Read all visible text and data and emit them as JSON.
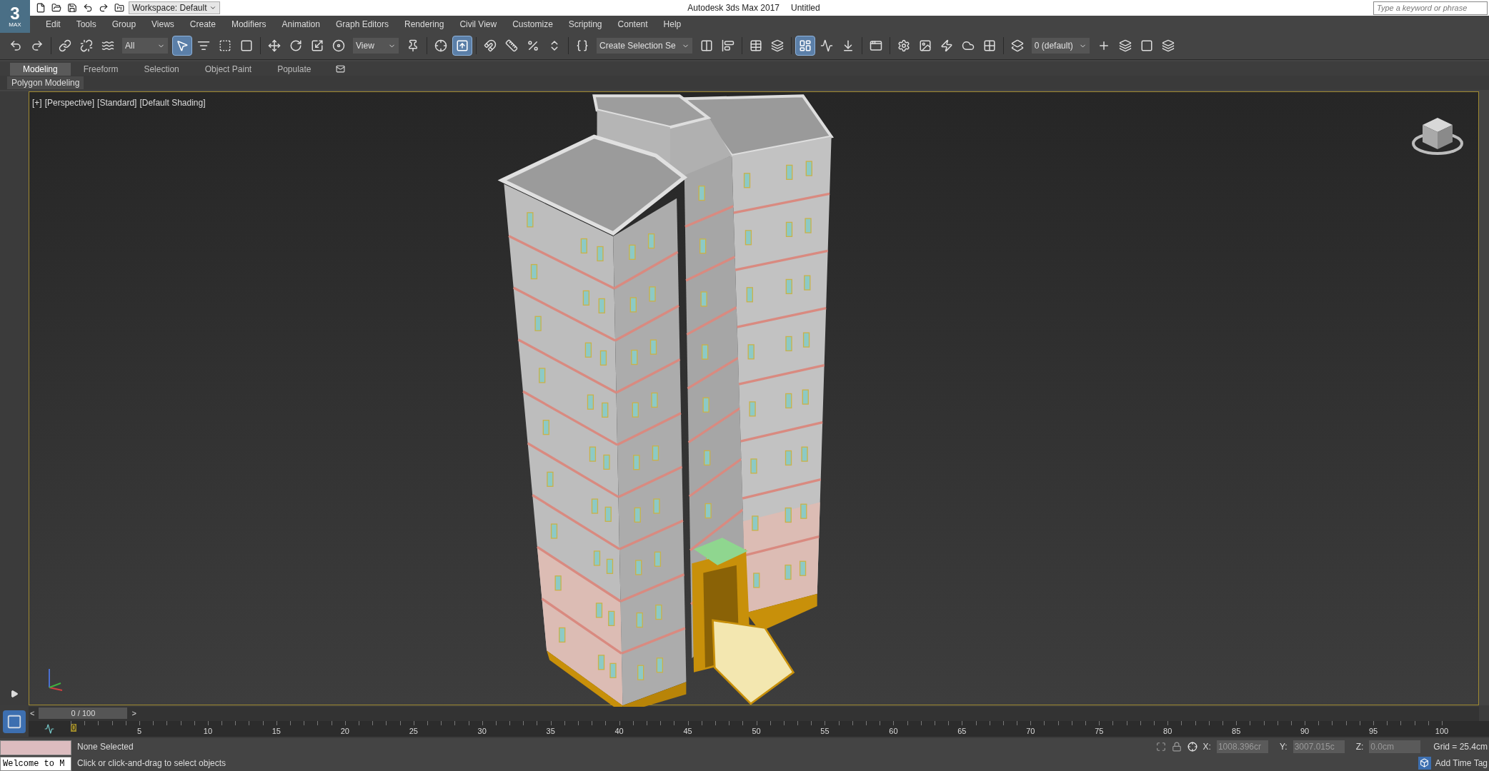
{
  "title_bar": {
    "logo_digit": "3",
    "logo_text": "MAX",
    "workspace": "Workspace: Default",
    "app_title": "Autodesk 3ds Max 2017",
    "document": "Untitled",
    "search": {
      "placeholder": "Type a keyword or phrase"
    }
  },
  "menu": [
    "Edit",
    "Tools",
    "Group",
    "Views",
    "Create",
    "Modifiers",
    "Animation",
    "Graph Editors",
    "Rendering",
    "Civil View",
    "Customize",
    "Scripting",
    "Content",
    "Help"
  ],
  "main_toolbar": [
    {
      "kind": "button",
      "selected": false
    },
    {
      "kind": "button",
      "selected": false
    },
    {
      "kind": "separator"
    },
    {
      "kind": "button",
      "selected": false
    },
    {
      "kind": "button",
      "selected": false
    },
    {
      "kind": "button",
      "selected": false
    },
    {
      "kind": "dropdown",
      "value": "All"
    },
    {
      "kind": "button",
      "selected": true
    },
    {
      "kind": "button",
      "selected": false
    },
    {
      "kind": "button",
      "selected": false
    },
    {
      "kind": "button",
      "selected": false
    },
    {
      "kind": "separator"
    },
    {
      "kind": "button",
      "selected": false
    },
    {
      "kind": "button",
      "selected": false
    },
    {
      "kind": "button",
      "selected": false
    },
    {
      "kind": "button",
      "selected": false
    },
    {
      "kind": "dropdown",
      "value": "View"
    },
    {
      "kind": "button",
      "selected": false
    },
    {
      "kind": "separator"
    },
    {
      "kind": "button",
      "selected": false
    },
    {
      "kind": "button",
      "selected": true
    },
    {
      "kind": "separator"
    },
    {
      "kind": "button",
      "selected": false
    },
    {
      "kind": "button",
      "selected": false
    },
    {
      "kind": "button",
      "selected": false
    },
    {
      "kind": "button",
      "selected": false
    },
    {
      "kind": "separator"
    },
    {
      "kind": "button",
      "selected": false
    },
    {
      "kind": "dropdown",
      "value": "Create Selection Se"
    },
    {
      "kind": "button",
      "selected": false
    },
    {
      "kind": "button",
      "selected": false
    },
    {
      "kind": "separator"
    },
    {
      "kind": "button",
      "selected": false
    },
    {
      "kind": "button",
      "selected": false
    },
    {
      "kind": "separator"
    },
    {
      "kind": "button",
      "selected": true
    },
    {
      "kind": "button",
      "selected": false
    },
    {
      "kind": "button",
      "selected": false
    },
    {
      "kind": "separator"
    },
    {
      "kind": "button",
      "selected": false
    },
    {
      "kind": "separator"
    },
    {
      "kind": "button",
      "selected": false
    },
    {
      "kind": "button",
      "selected": false
    },
    {
      "kind": "button",
      "selected": false
    },
    {
      "kind": "button",
      "selected": false
    },
    {
      "kind": "button",
      "selected": false
    },
    {
      "kind": "separator"
    },
    {
      "kind": "button",
      "selected": false
    },
    {
      "kind": "dropdown",
      "value": "0 (default)"
    },
    {
      "kind": "button",
      "selected": false
    },
    {
      "kind": "button",
      "selected": false
    },
    {
      "kind": "button",
      "selected": false
    },
    {
      "kind": "button",
      "selected": false
    }
  ],
  "ribbon": {
    "tabs": [
      {
        "label": "Modeling",
        "selected": true
      },
      {
        "label": "Freeform",
        "selected": false
      },
      {
        "label": "Selection",
        "selected": false
      },
      {
        "label": "Object Paint",
        "selected": false
      },
      {
        "label": "Populate",
        "selected": false
      }
    ],
    "panel": "Polygon Modeling"
  },
  "viewport": {
    "labels": [
      "[+]",
      "[Perspective]",
      "[Standard]",
      "[Default Shading]"
    ]
  },
  "time_slider": {
    "prev": "<",
    "frame": "0 / 100",
    "next": ">"
  },
  "track_bar": {
    "ticks": [
      "0",
      "5",
      "10",
      "15",
      "20",
      "25",
      "30",
      "35",
      "40",
      "45",
      "50",
      "55",
      "60",
      "65",
      "70",
      "75",
      "80",
      "85",
      "90",
      "95",
      "100"
    ]
  },
  "status_bar": {
    "listener": "Welcome to M",
    "selection": "None Selected",
    "prompt": "Click or click-and-drag to select objects",
    "x_label": "X:",
    "x_value": "1008.396cr",
    "y_label": "Y:",
    "y_value": "3007.015c",
    "z_label": "Z:",
    "z_value": "0.0cm",
    "grid": "Grid = 25.4cm",
    "time_tag": "Add Time Tag"
  }
}
